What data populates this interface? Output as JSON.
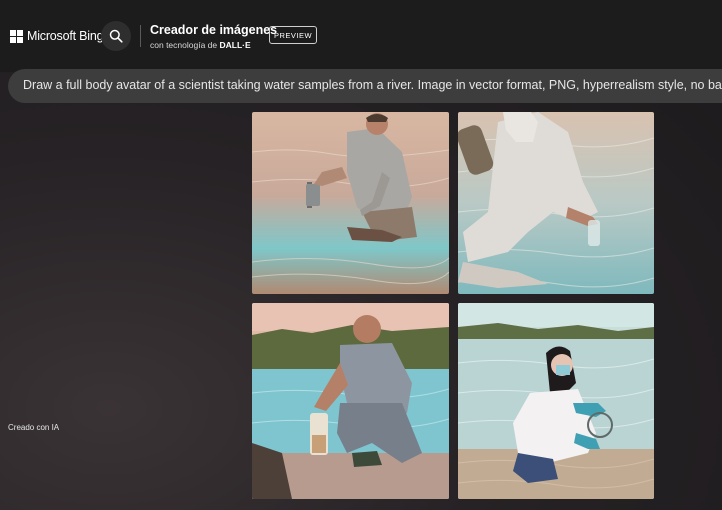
{
  "header": {
    "brand": "Microsoft Bing",
    "title": "Creador de imágenes",
    "subtitle_prefix": "con tecnología de ",
    "subtitle_brand": "DALL·E",
    "badge": "PREVIEW",
    "search_icon": "search-icon",
    "logo_icon": "windows-logo-icon"
  },
  "prompt": {
    "text": "Draw a full body avatar of a scientist taking water samples from a river. Image in vector format, PNG, hyperrealism style, no backgrour"
  },
  "sidebar": {
    "created_label": "Creado con IA"
  },
  "results": {
    "images": [
      {
        "subject": "man in grey shirt crouching in river holding sample jar"
      },
      {
        "subject": "scientist in white protective suit with tank collecting sample"
      },
      {
        "subject": "bald man crouching at riverbank holding sample bottle"
      },
      {
        "subject": "woman in white lab coat and mask with teal gloves collecting sample"
      }
    ]
  },
  "colors": {
    "topbar": "#1c1c1c",
    "prompt_bar": "#3d3d3d",
    "background": "#262225"
  }
}
